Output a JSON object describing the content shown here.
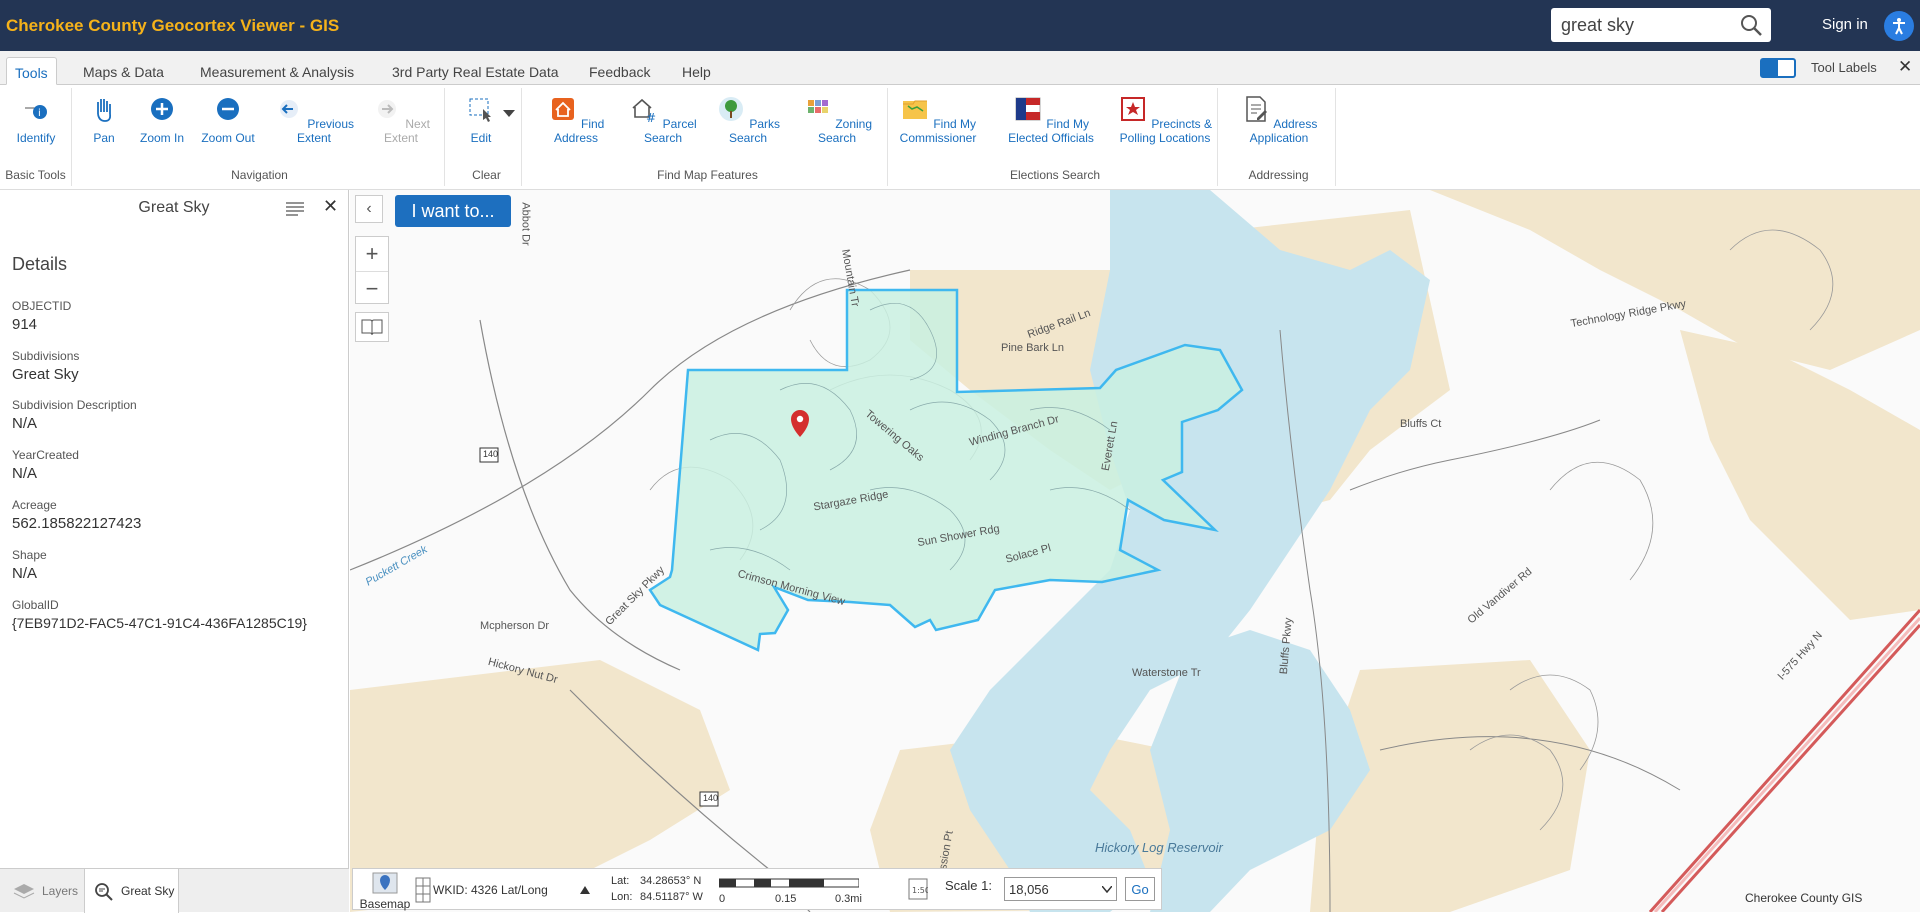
{
  "app": {
    "title": "Cherokee County Geocortex Viewer - GIS",
    "search_value": "great sky",
    "signin_label": "Sign in"
  },
  "tabs": [
    {
      "label": "Tools",
      "active": true
    },
    {
      "label": "Maps & Data"
    },
    {
      "label": "Measurement & Analysis"
    },
    {
      "label": "3rd Party Real Estate Data"
    },
    {
      "label": "Feedback"
    },
    {
      "label": "Help"
    }
  ],
  "tool_labels": "Tool Labels",
  "ribbon": {
    "groups": [
      {
        "title": "Basic Tools",
        "tools": [
          "Identify"
        ]
      },
      {
        "title": "Navigation",
        "tools": [
          "Pan",
          "Zoom In",
          "Zoom Out",
          "Previous Extent",
          "Next Extent"
        ]
      },
      {
        "title": "Clear",
        "tools": [
          "Edit"
        ]
      },
      {
        "title": "Find Map Features",
        "tools": [
          "Find Address",
          "Parcel Search",
          "Parks Search",
          "Zoning Search"
        ]
      },
      {
        "title": "Elections Search",
        "tools": [
          "Find My Commissioner",
          "Find My Elected Officials",
          "Precincts & Polling Locations"
        ]
      },
      {
        "title": "Addressing",
        "tools": [
          "Address Application"
        ]
      }
    ]
  },
  "panel": {
    "title": "Great Sky",
    "details_heading": "Details",
    "fields": [
      {
        "label": "OBJECTID",
        "value": "914"
      },
      {
        "label": "Subdivisions",
        "value": "Great Sky"
      },
      {
        "label": "Subdivision Description",
        "value": "N/A"
      },
      {
        "label": "YearCreated",
        "value": "N/A"
      },
      {
        "label": "Acreage",
        "value": "562.185822127423"
      },
      {
        "label": "Shape",
        "value": "N/A"
      },
      {
        "label": "GlobalID",
        "value": "{7EB971D2-FAC5-47C1-91C4-436FA1285C19}"
      }
    ],
    "bottom_tabs": [
      "Layers",
      "Great Sky"
    ]
  },
  "map": {
    "i_want_to": "I want to...",
    "labels": [
      "Abbot Dr",
      "Mountain Tr",
      "Pine Bark Ln",
      "Ridge Rail Ln",
      "Towering Oaks",
      "Winding Branch Dr",
      "Everett Ln",
      "Stargaze Ridge",
      "Sun Shower Rdg",
      "Solace Pl",
      "Crimson Morning View",
      "Great Sky Pkwy",
      "Waterstone Tr",
      "Hickory Log Reservoir",
      "Puckett Creek",
      "Mcpherson Dr",
      "Bluffs Pkwy",
      "Technology Ridge Pkwy",
      "Bluffs Ct",
      "Hickory Nut Dr",
      "Old Vandiver Rd",
      "I-575 Hwy N",
      "Mission Pt",
      "140"
    ],
    "road_badge": "140",
    "credit": "Cherokee County GIS"
  },
  "status": {
    "basemap_label": "Basemap",
    "wkid": "WKID: 4326 Lat/Long",
    "lat_label": "Lat:",
    "lat": "34.28653° N",
    "lon_label": "Lon:",
    "lon": "84.51187° W",
    "scale_ticks": [
      "0",
      "0.15",
      "0.3mi"
    ],
    "scale_label": "Scale 1:",
    "scale_value": "18,056",
    "go_label": "Go"
  },
  "colors": {
    "topbar": "#233554",
    "title": "#f5b21a",
    "accent": "#1d6fbf",
    "polygon_fill": "#c9f0e0",
    "polygon_stroke": "#3fb8ef",
    "water": "#c7e4ee",
    "land": "#f2e6cc"
  }
}
